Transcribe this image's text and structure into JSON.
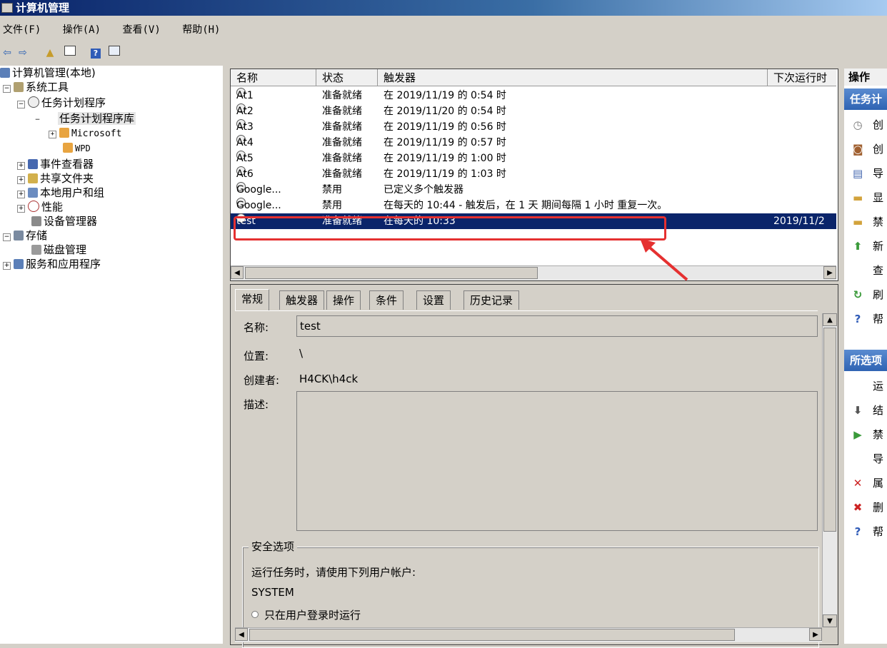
{
  "window": {
    "title": "计算机管理"
  },
  "menu": [
    "文件(F)",
    "操作(A)",
    "查看(V)",
    "帮助(H)"
  ],
  "tree": {
    "root": "计算机管理(本地)",
    "system_tools": "系统工具",
    "task_scheduler": "任务计划程序",
    "task_library": "任务计划程序库",
    "microsoft": "Microsoft",
    "wpd": "WPD",
    "event_viewer": "事件查看器",
    "shared_folders": "共享文件夹",
    "local_users": "本地用户和组",
    "performance": "性能",
    "device_manager": "设备管理器",
    "storage": "存储",
    "disk_mgmt": "磁盘管理",
    "services_apps": "服务和应用程序"
  },
  "list": {
    "columns": [
      "名称",
      "状态",
      "触发器",
      "下次运行时"
    ],
    "rows": [
      {
        "name": "At1",
        "status": "准备就绪",
        "trigger": "在 2019/11/19 的 0:54 时",
        "next": ""
      },
      {
        "name": "At2",
        "status": "准备就绪",
        "trigger": "在 2019/11/20 的 0:54 时",
        "next": ""
      },
      {
        "name": "At3",
        "status": "准备就绪",
        "trigger": "在 2019/11/19 的 0:56 时",
        "next": ""
      },
      {
        "name": "At4",
        "status": "准备就绪",
        "trigger": "在 2019/11/19 的 0:57 时",
        "next": ""
      },
      {
        "name": "At5",
        "status": "准备就绪",
        "trigger": "在 2019/11/19 的 1:00 时",
        "next": ""
      },
      {
        "name": "At6",
        "status": "准备就绪",
        "trigger": "在 2019/11/19 的 1:03 时",
        "next": ""
      },
      {
        "name": "Google...",
        "status": "禁用",
        "trigger": "已定义多个触发器",
        "next": ""
      },
      {
        "name": "Google...",
        "status": "禁用",
        "trigger": "在每天的 10:44 - 触发后，在 1 天 期间每隔 1 小时 重复一次。",
        "next": ""
      },
      {
        "name": "test",
        "status": "准备就绪",
        "trigger": "在每天的 10:33",
        "next": "2019/11/2"
      }
    ],
    "selected_index": 8
  },
  "tabs": [
    "常规",
    "触发器",
    "操作",
    "条件",
    "设置",
    "历史记录"
  ],
  "general": {
    "name_label": "名称:",
    "name_value": "test",
    "location_label": "位置:",
    "location_value": "\\",
    "author_label": "创建者:",
    "author_value": "H4CK\\h4ck",
    "desc_label": "描述:",
    "desc_value": "",
    "security_title": "安全选项",
    "run_as_text": "运行任务时，请使用下列用户帐户:",
    "account": "SYSTEM",
    "radio_logged_on": "只在用户登录时运行"
  },
  "actions": {
    "header": "操作",
    "section1": "任务计",
    "items1": [
      {
        "icon": "clock-icon",
        "label": "创"
      },
      {
        "icon": "task-icon",
        "label": "创"
      },
      {
        "icon": "import-icon",
        "label": "导"
      },
      {
        "icon": "folder-icon",
        "label": "显"
      },
      {
        "icon": "folder-icon",
        "label": "禁"
      },
      {
        "icon": "new-folder-icon",
        "label": "新"
      },
      {
        "icon": "none",
        "label": "查"
      },
      {
        "icon": "refresh-icon",
        "label": "刷"
      },
      {
        "icon": "help-icon",
        "label": "帮"
      }
    ],
    "section2": "所选项",
    "items2": [
      {
        "icon": "none",
        "label": "运"
      },
      {
        "icon": "down-arrow-icon",
        "label": "结"
      },
      {
        "icon": "play-icon",
        "label": "禁"
      },
      {
        "icon": "none",
        "label": "导"
      },
      {
        "icon": "x-icon",
        "label": "属"
      },
      {
        "icon": "delete-icon",
        "label": "删"
      },
      {
        "icon": "help-icon",
        "label": "帮"
      }
    ]
  },
  "colors": {
    "selection": "#0a246a",
    "highlight_box": "#e53030",
    "action_header": "#2f63b3"
  }
}
